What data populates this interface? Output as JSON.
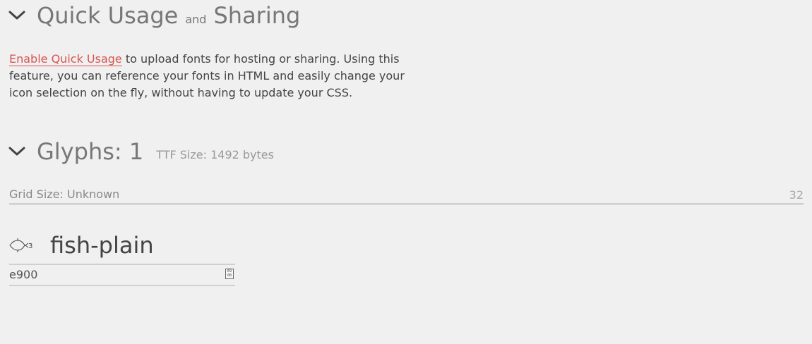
{
  "quick_usage": {
    "title_part1": "Quick Usage",
    "title_and": "and",
    "title_part2": "Sharing",
    "link_text": "Enable Quick Usage",
    "description": " to upload fonts for hosting or sharing. Using this feature, you can reference your fonts in HTML and easily change your icon selection on the fly, without having to update your CSS."
  },
  "glyphs": {
    "title": "Glyphs: 1",
    "ttf_size": "TTF Size: 1492 bytes",
    "grid_size_label": "Grid Size: Unknown",
    "grid_size_value": "32"
  },
  "glyph_card": {
    "icon": "fish-icon",
    "name": "fish-plain",
    "code": "e900",
    "code_icon_label": "E9\n00"
  },
  "colors": {
    "link": "#d9534f",
    "background": "#f0f0f0"
  }
}
